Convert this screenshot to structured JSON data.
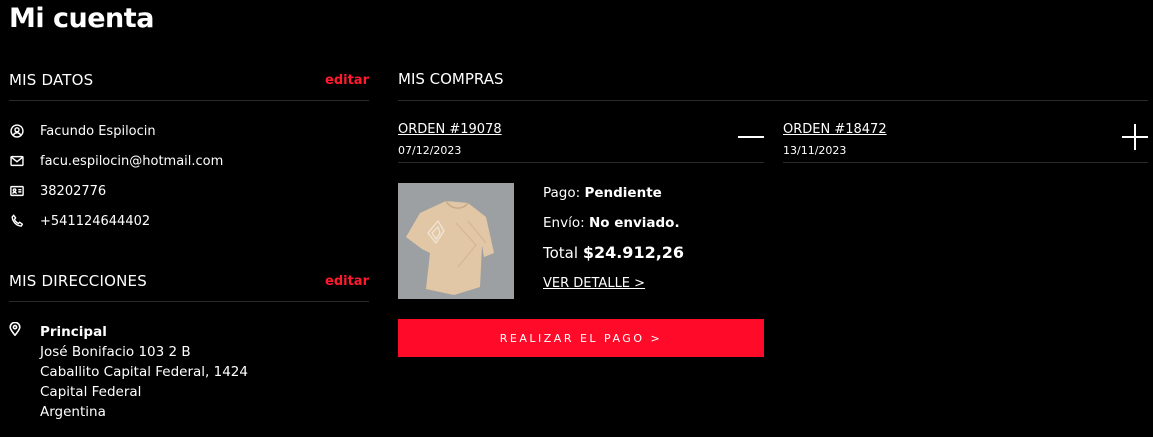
{
  "page": {
    "title": "Mi cuenta"
  },
  "mis_datos": {
    "title": "MIS DATOS",
    "edit_label": "editar",
    "name": "Facundo Espilocin",
    "email": "facu.espilocin@hotmail.com",
    "document": "38202776",
    "phone": "+541124644402"
  },
  "mis_direcciones": {
    "title": "MIS DIRECCIONES",
    "edit_label": "editar",
    "address": {
      "label": "Principal",
      "street": "José Bonifacio 103 2 B",
      "city": "Caballito Capital Federal, 1424",
      "province": "Capital Federal",
      "country": "Argentina"
    }
  },
  "mis_compras": {
    "title": "MIS COMPRAS",
    "orders": [
      {
        "number": "ORDEN #19078",
        "date": "07/12/2023",
        "expanded": true,
        "payment_label": "Pago:",
        "payment_status": "Pendiente",
        "shipping_label": "Envío:",
        "shipping_status": "No enviado.",
        "total_label": "Total",
        "total_value": "$24.912,26",
        "detail_link": "VER DETALLE >",
        "pay_button": "REALIZAR EL PAGO >"
      },
      {
        "number": "ORDEN #18472",
        "date": "13/11/2023",
        "expanded": false
      }
    ]
  },
  "colors": {
    "background": "#000000",
    "accent": "#ff0a28",
    "text": "#ffffff"
  },
  "icons": [
    "user-icon",
    "mail-icon",
    "id-card-icon",
    "phone-icon",
    "location-pin-icon",
    "minus-icon",
    "plus-icon"
  ]
}
